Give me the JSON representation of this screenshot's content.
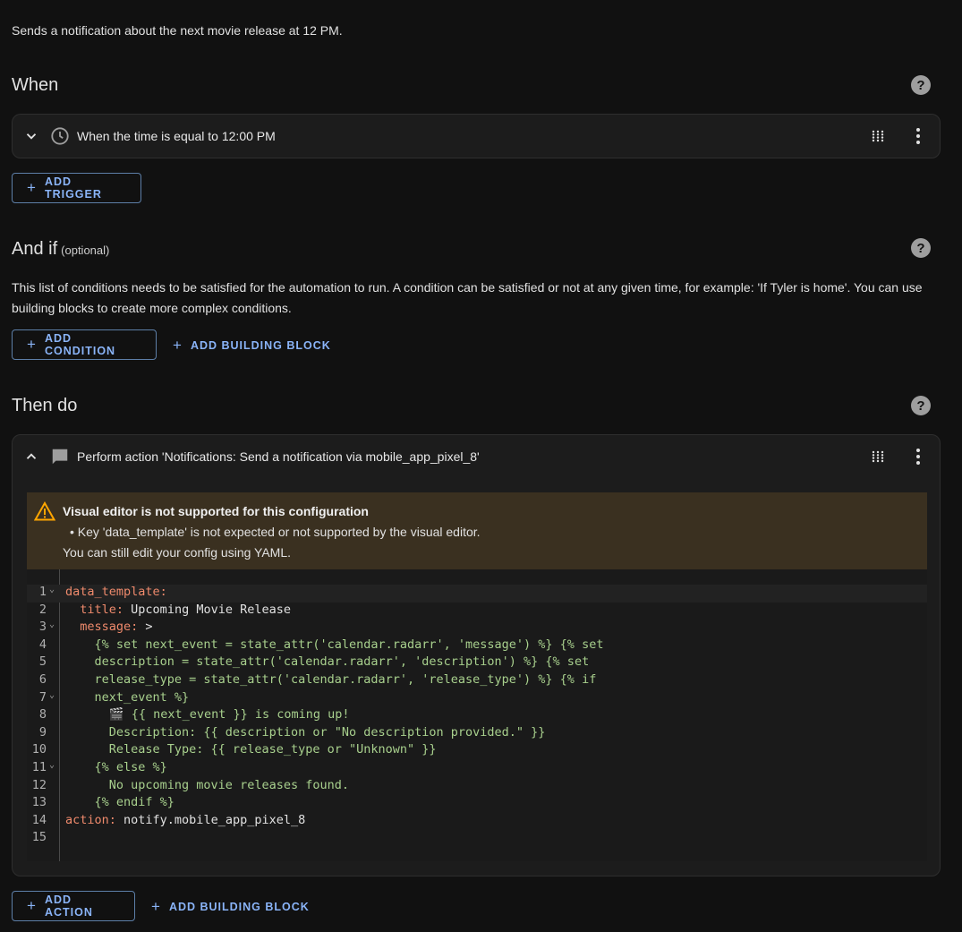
{
  "description": "Sends a notification about the next movie release at 12 PM.",
  "when": {
    "title": "When",
    "trigger": {
      "label": "When the time is equal to 12:00 PM",
      "icon": "clock-icon"
    },
    "add_trigger": "ADD TRIGGER"
  },
  "and_if": {
    "title": "And if",
    "optional": "(optional)",
    "help_text": "This list of conditions needs to be satisfied for the automation to run. A condition can be satisfied or not at any given time, for example: 'If Tyler is home'. You can use building blocks to create more complex conditions.",
    "add_condition": "ADD CONDITION",
    "add_building_block": "ADD BUILDING BLOCK"
  },
  "then_do": {
    "title": "Then do",
    "action": {
      "label": "Perform action 'Notifications: Send a notification via mobile_app_pixel_8'",
      "icon": "message-icon"
    },
    "alert": {
      "title": "Visual editor is not supported for this configuration",
      "item": "Key 'data_template' is not expected or not supported by the visual editor.",
      "footer": "You can still edit your config using YAML."
    },
    "code_lines": [
      {
        "n": "1",
        "fold": true,
        "key": "data_template:",
        "val": ""
      },
      {
        "n": "2",
        "fold": false,
        "indent": "  ",
        "key": "title:",
        "val": " Upcoming Movie Release"
      },
      {
        "n": "3",
        "fold": true,
        "indent": "  ",
        "key": "message:",
        "val": " >"
      },
      {
        "n": "4",
        "fold": false,
        "tpl": "    {% set next_event = state_attr('calendar.radarr', 'message') %} {% set"
      },
      {
        "n": "5",
        "fold": false,
        "tpl": "    description = state_attr('calendar.radarr', 'description') %} {% set"
      },
      {
        "n": "6",
        "fold": false,
        "tpl": "    release_type = state_attr('calendar.radarr', 'release_type') %} {% if"
      },
      {
        "n": "7",
        "fold": true,
        "tpl": "    next_event %}"
      },
      {
        "n": "8",
        "fold": false,
        "tpl": "      🎬 {{ next_event }} is coming up!"
      },
      {
        "n": "9",
        "fold": false,
        "tpl": "      Description: {{ description or \"No description provided.\" }}"
      },
      {
        "n": "10",
        "fold": false,
        "tpl": "      Release Type: {{ release_type or \"Unknown\" }}"
      },
      {
        "n": "11",
        "fold": true,
        "tpl": "    {% else %}"
      },
      {
        "n": "12",
        "fold": false,
        "tpl": "      No upcoming movie releases found."
      },
      {
        "n": "13",
        "fold": false,
        "tpl": "    {% endif %}"
      },
      {
        "n": "14",
        "fold": false,
        "key": "action:",
        "val": " notify.mobile_app_pixel_8"
      },
      {
        "n": "15",
        "fold": false,
        "tpl": ""
      }
    ],
    "add_action": "ADD ACTION",
    "add_building_block": "ADD BUILDING BLOCK"
  },
  "help_icon": "?",
  "plus": "+",
  "colors": {
    "accent": "#8ab4f8",
    "warning": "#ffa600",
    "key": "#ef8a6c",
    "template": "#a8d08d"
  }
}
